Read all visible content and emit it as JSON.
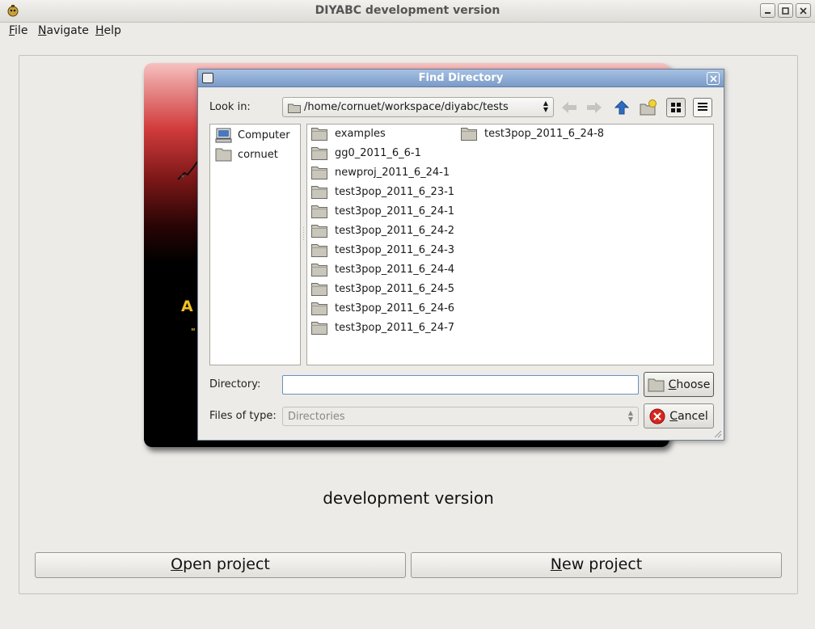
{
  "window": {
    "title": "DIYABC development version"
  },
  "menu": [
    {
      "label": "File",
      "mnemonic": "F"
    },
    {
      "label": "Navigate",
      "mnemonic": "N"
    },
    {
      "label": "Help",
      "mnemonic": "H"
    }
  ],
  "main": {
    "subtitle": "development version",
    "open_button": {
      "mnemonic": "O",
      "rest": "pen project"
    },
    "new_button": {
      "mnemonic": "N",
      "rest": "ew project"
    }
  },
  "dialog": {
    "title": "Find Directory",
    "look_in_label": "Look in:",
    "look_in_path": "/home/cornuet/workspace/diyabc/tests",
    "tools": [
      "back-arrow-icon",
      "forward-arrow-icon",
      "up-arrow-icon",
      "new-folder-icon",
      "list-mode-icon",
      "detail-mode-icon"
    ],
    "sidebar": [
      {
        "label": "Computer",
        "icon": "computer-icon"
      },
      {
        "label": "cornuet",
        "icon": "folder-icon"
      }
    ],
    "files_col1": [
      "examples",
      "gg0_2011_6_6-1",
      "newproj_2011_6_24-1",
      "test3pop_2011_6_23-1",
      "test3pop_2011_6_24-1",
      "test3pop_2011_6_24-2",
      "test3pop_2011_6_24-3",
      "test3pop_2011_6_24-4",
      "test3pop_2011_6_24-5",
      "test3pop_2011_6_24-6",
      "test3pop_2011_6_24-7"
    ],
    "files_col2": [
      "test3pop_2011_6_24-8"
    ],
    "directory_label": "Directory:",
    "directory_value": "",
    "files_of_type_label": "Files of type:",
    "files_of_type_value": "Directories",
    "choose_button": {
      "mnemonic": "C",
      "rest": "hoose"
    },
    "cancel_button": {
      "mnemonic": "C",
      "rest": "ancel"
    }
  }
}
